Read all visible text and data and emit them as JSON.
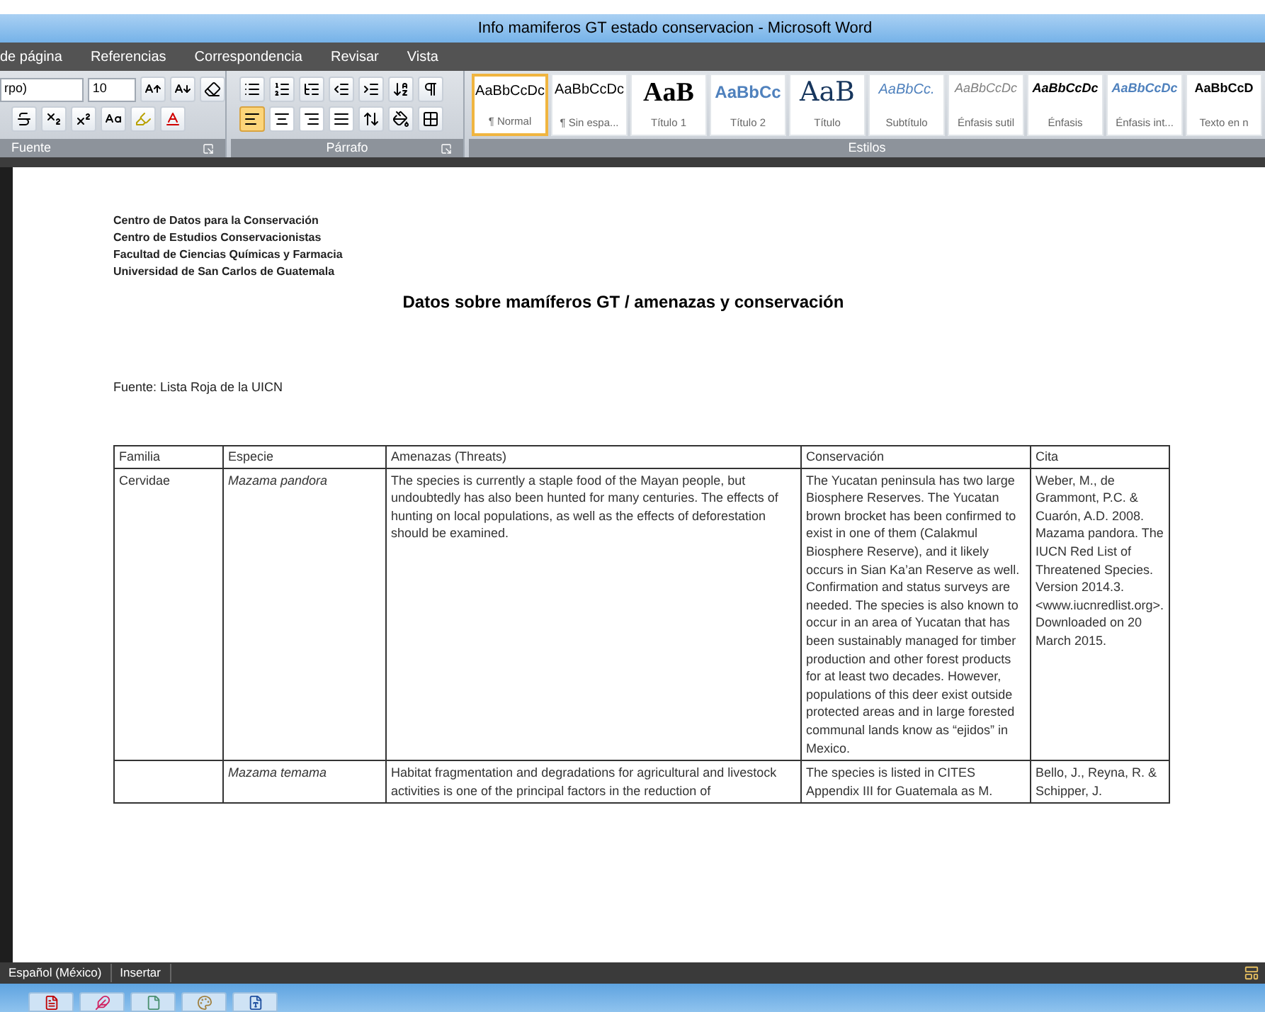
{
  "window": {
    "title": "Info mamiferos GT estado conservacion - Microsoft Word"
  },
  "tabs": [
    "de página",
    "Referencias",
    "Correspondencia",
    "Revisar",
    "Vista"
  ],
  "ribbon": {
    "font": {
      "font_name": "rpo)",
      "font_size": "10",
      "group_label": "Fuente"
    },
    "paragraph": {
      "group_label": "Párrafo",
      "alignments": [
        {
          "selected": true
        },
        {
          "selected": false
        },
        {
          "selected": false
        },
        {
          "selected": false
        }
      ]
    },
    "styles": {
      "group_label": "Estilos",
      "items": [
        {
          "sample": "AaBbCcDc",
          "name": "¶ Normal",
          "kind": "normal",
          "selected": true
        },
        {
          "sample": "AaBbCcDc",
          "name": "¶ Sin espa...",
          "kind": "normal",
          "selected": false
        },
        {
          "sample": "AaB",
          "name": "Título 1",
          "kind": "heading1",
          "selected": false
        },
        {
          "sample": "AaBbCc",
          "name": "Título 2",
          "kind": "heading2",
          "selected": false
        },
        {
          "sample": "AaB",
          "name": "Título",
          "kind": "title",
          "selected": false
        },
        {
          "sample": "AaBbCc.",
          "name": "Subtítulo",
          "kind": "subtitle",
          "selected": false
        },
        {
          "sample": "AaBbCcDc",
          "name": "Énfasis sutil",
          "kind": "subtle",
          "selected": false
        },
        {
          "sample": "AaBbCcDc",
          "name": "Énfasis",
          "kind": "emphasis",
          "selected": false
        },
        {
          "sample": "AaBbCcDc",
          "name": "Énfasis int...",
          "kind": "intense",
          "selected": false
        },
        {
          "sample": "AaBbCcD",
          "name": "Texto en n",
          "kind": "strong",
          "selected": false
        }
      ]
    }
  },
  "document": {
    "header_lines": [
      "Centro de Datos para la Conservación",
      "Centro de Estudios Conservacionistas",
      "Facultad de Ciencias Químicas y Farmacia",
      "Universidad de San Carlos de Guatemala"
    ],
    "title": "Datos sobre mamíferos GT / amenazas y conservación",
    "source": "Fuente: Lista Roja de la UICN",
    "table": {
      "columns": [
        "Familia",
        "Especie",
        "Amenazas (Threats)",
        "Conservación",
        "Cita"
      ],
      "rows": [
        {
          "familia": "Cervidae",
          "especie": "Mazama pandora",
          "amenazas": "The species is currently a staple food of the Mayan people, but undoubtedly has also been hunted for many centuries. The effects of hunting on local populations, as well as the effects of deforestation should be examined.",
          "conservacion": "The Yucatan peninsula has two large Biosphere Reserves. The Yucatan brown brocket has been confirmed to exist in one of them (Calakmul Biosphere Reserve), and it likely occurs in Sian Ka’an Reserve as well. Confirmation and status surveys are needed. The species is also known to occur in an area of Yucatan that has been sustainably managed for timber production and other forest products for at least two decades. However, populations of this deer exist outside protected areas and in large forested communal lands know as “ejidos” in Mexico.",
          "cita": "Weber, M., de Grammont, P.C. & Cuarón, A.D. 2008. Mazama pandora. The IUCN Red List of Threatened Species. Version 2014.3. <www.iucnredlist.org>. Downloaded on 20 March 2015."
        },
        {
          "especie": "Mazama temama",
          "amenazas": "Habitat fragmentation and degradations for agricultural and livestock activities is one of the principal factors in the reduction of",
          "conservacion": "The species is listed in CITES Appendix III for Guatemala as M.",
          "cita": "Bello, J., Reyna, R. & Schipper, J."
        }
      ]
    }
  },
  "status_bar": [
    "Español (México)",
    "Insertar"
  ]
}
